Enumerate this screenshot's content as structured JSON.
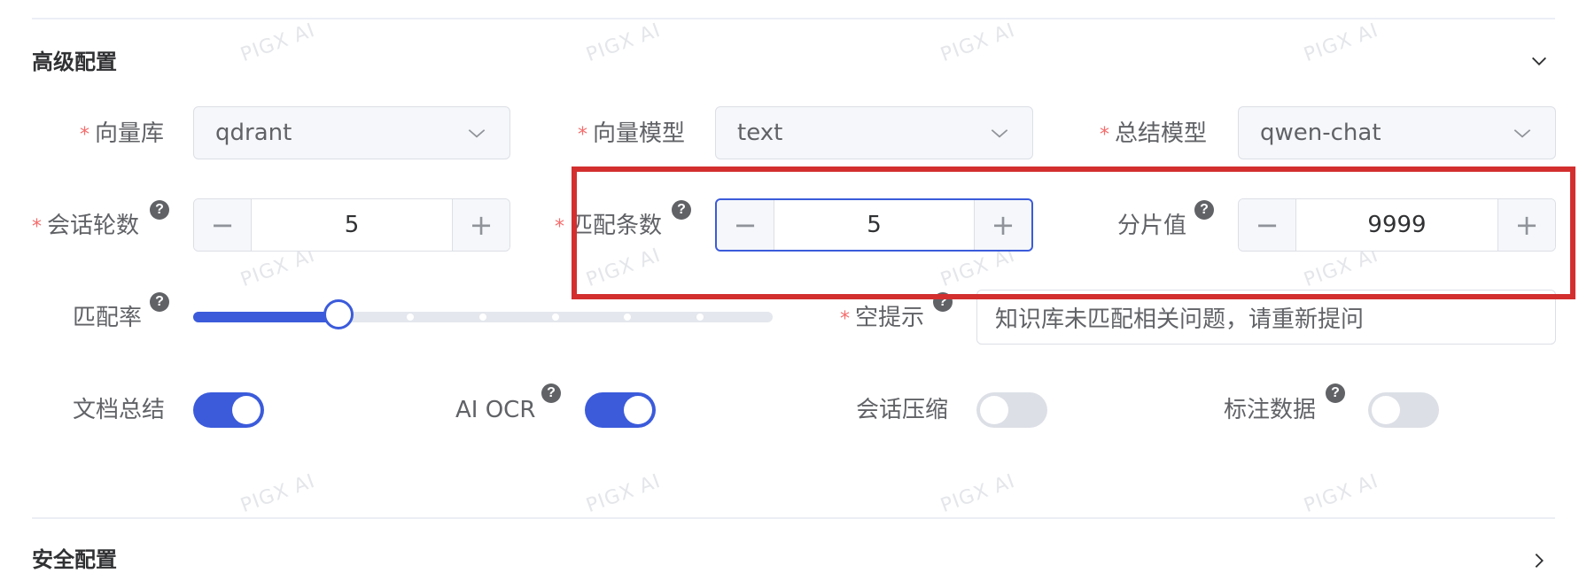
{
  "sections": {
    "advanced": {
      "title": "高级配置"
    },
    "security": {
      "title": "安全配置"
    }
  },
  "fields": {
    "vector_db": {
      "label": "向量库",
      "value": "qdrant"
    },
    "vector_model": {
      "label": "向量模型",
      "value": "text"
    },
    "summary_model": {
      "label": "总结模型",
      "value": "qwen-chat"
    },
    "chat_rounds": {
      "label": "会话轮数",
      "value": "5"
    },
    "match_count": {
      "label": "匹配条数",
      "value": "5"
    },
    "chunk_size": {
      "label": "分片值",
      "value": "9999"
    },
    "match_rate": {
      "label": "匹配率",
      "value": 0.25
    },
    "empty_hint": {
      "label": "空提示",
      "value": "知识库未匹配相关问题，请重新提问"
    },
    "doc_summary": {
      "label": "文档总结",
      "on": true
    },
    "ai_ocr": {
      "label": "AI OCR",
      "on": true
    },
    "chat_compress": {
      "label": "会话压缩",
      "on": false
    },
    "annotate": {
      "label": "标注数据",
      "on": false
    }
  },
  "symbols": {
    "required": "*",
    "help": "?",
    "minus": "−",
    "plus": "+"
  },
  "icons": {
    "chevron_down": "chevron-down-icon",
    "chevron_right": "chevron-right-icon",
    "select_arrow": "chevron-down-icon",
    "help": "question-circle-icon"
  },
  "watermark": "PIGX AI",
  "colors": {
    "accent": "#3b5bdb",
    "required": "#f56c6c",
    "highlight": "#d32f2f"
  }
}
